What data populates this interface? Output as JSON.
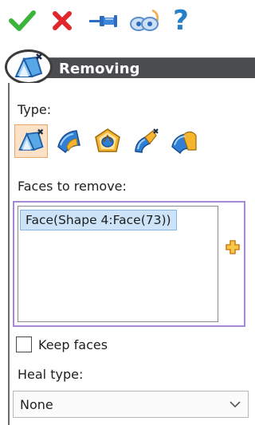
{
  "toolbar": {
    "ok_icon": "check-icon",
    "cancel_icon": "x-icon",
    "pin_icon": "pushpin-icon",
    "preview_icon": "preview-eyes-icon",
    "help_icon": "help-icon",
    "help_glyph": "?"
  },
  "header": {
    "title": "Removing",
    "icon": "remove-faces-icon"
  },
  "type": {
    "label": "Type:",
    "options": [
      {
        "icon": "remove-faces-icon",
        "selected": true
      },
      {
        "icon": "remove-fillets-icon",
        "selected": false
      },
      {
        "icon": "remove-holes-icon",
        "selected": false
      },
      {
        "icon": "remove-chamfers-icon",
        "selected": false
      },
      {
        "icon": "remove-rounds-icon",
        "selected": false
      }
    ]
  },
  "faces": {
    "label": "Faces to remove:",
    "items": [
      "Face(Shape 4:Face(73))"
    ],
    "add_icon": "add-plus-icon"
  },
  "keep_faces": {
    "label": "Keep faces",
    "checked": false
  },
  "heal": {
    "label": "Heal type:",
    "value": "None"
  },
  "colors": {
    "header_bar": "#4b4c50",
    "selection_border": "#a48ad4",
    "item_highlight": "#cde4f8",
    "selected_type_bg": "#fbe1c6",
    "ok_green": "#3cb43c",
    "cancel_red": "#e0282c",
    "help_blue": "#2680c8"
  }
}
